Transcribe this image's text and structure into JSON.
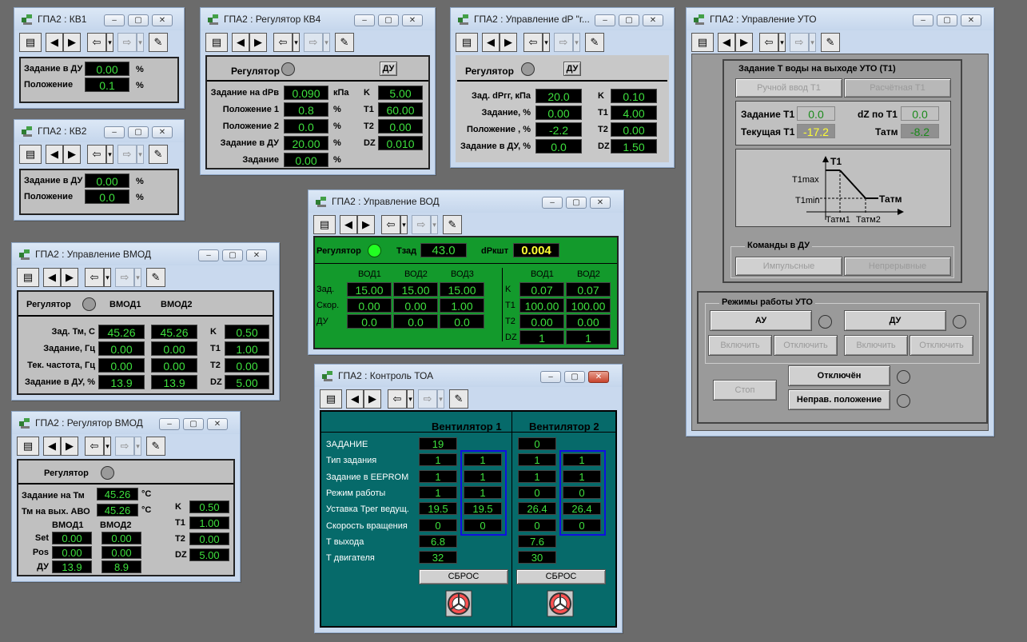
{
  "toolbar": {
    "buttons": [
      "print",
      "back",
      "forward",
      "undo",
      "redo",
      "pin"
    ],
    "icons": {
      "print": "▤",
      "back": "◀",
      "forward": "▶",
      "undo": "⇦",
      "redo": "⇨",
      "dropdown": "▾",
      "pin": "✎"
    }
  },
  "window_controls": {
    "minimize": "–",
    "restore": "▢",
    "close": "✕"
  },
  "kv1": {
    "title": "ГПА2 : КВ1",
    "rows": [
      {
        "label": "Задание в ДУ",
        "value": "0.00",
        "unit": "%"
      },
      {
        "label": "Положение",
        "value": "0.1",
        "unit": "%"
      }
    ]
  },
  "kv2": {
    "title": "ГПА2 : КВ2",
    "rows": [
      {
        "label": "Задание в ДУ",
        "value": "0.00",
        "unit": "%"
      },
      {
        "label": "Положение",
        "value": "0.0",
        "unit": "%"
      }
    ]
  },
  "kv4": {
    "title": "ГПА2 : Регулятор КВ4",
    "regulator_label": "Регулятор",
    "du_label": "ДУ",
    "rows": [
      {
        "label": "Задание на dPв",
        "value": "0.090",
        "unit": "кПа"
      },
      {
        "label": "Положение 1",
        "value": "0.8",
        "unit": "%"
      },
      {
        "label": "Положение 2",
        "value": "0.0",
        "unit": "%"
      },
      {
        "label": "Задание в ДУ",
        "value": "20.00",
        "unit": "%"
      },
      {
        "label": "Задание",
        "value": "0.00",
        "unit": "%"
      }
    ],
    "params": [
      {
        "label": "K",
        "value": "5.00"
      },
      {
        "label": "T1",
        "value": "60.00"
      },
      {
        "label": "T2",
        "value": "0.00"
      },
      {
        "label": "DZ",
        "value": "0.010"
      }
    ]
  },
  "dp": {
    "title": "ГПА2 : Управление dP \"г...",
    "regulator_label": "Регулятор",
    "du_label": "ДУ",
    "rows": [
      {
        "label": "Зад. dPгг, кПа",
        "value": "20.0"
      },
      {
        "label": "Задание, %",
        "value": "0.00"
      },
      {
        "label": "Положение , %",
        "value": "-2.2"
      },
      {
        "label": "Задание в ДУ, %",
        "value": "0.0"
      }
    ],
    "params": [
      {
        "label": "K",
        "value": "0.10"
      },
      {
        "label": "T1",
        "value": "4.00"
      },
      {
        "label": "T2",
        "value": "0.00"
      },
      {
        "label": "DZ",
        "value": "1.50"
      }
    ]
  },
  "vmod": {
    "title": "ГПА2 : Управление ВМОД",
    "regulator_label": "Регулятор",
    "col1": "ВМОД1",
    "col2": "ВМОД2",
    "rows": [
      {
        "label": "Зад. Тм, С",
        "v1": "45.26",
        "v2": "45.26"
      },
      {
        "label": "Задание, Гц",
        "v1": "0.00",
        "v2": "0.00"
      },
      {
        "label": "Тек. частота, Гц",
        "v1": "0.00",
        "v2": "0.00"
      },
      {
        "label": "Задание в ДУ, %",
        "v1": "13.9",
        "v2": "13.9"
      }
    ],
    "params": [
      {
        "label": "K",
        "value": "0.50"
      },
      {
        "label": "T1",
        "value": "1.00"
      },
      {
        "label": "T2",
        "value": "0.00"
      },
      {
        "label": "DZ",
        "value": "5.00"
      }
    ]
  },
  "regvmod": {
    "title": "ГПА2 : Регулятор ВМОД",
    "regulator_label": "Регулятор",
    "set_tm_label": "Задание на Тм",
    "set_tm_value": "45.26",
    "tm_out_label": "Тм на вых. АВО",
    "tm_out_value": "45.26",
    "temp_unit": "°C",
    "col1": "ВМОД1",
    "col2": "ВМОД2",
    "rows": [
      {
        "label": "Set",
        "v1": "0.00",
        "v2": "0.00"
      },
      {
        "label": "Pos",
        "v1": "0.00",
        "v2": "0.00"
      },
      {
        "label": "ДУ",
        "v1": "13.9",
        "v2": "8.9"
      }
    ],
    "params": [
      {
        "label": "K",
        "value": "0.50"
      },
      {
        "label": "T1",
        "value": "1.00"
      },
      {
        "label": "T2",
        "value": "0.00"
      },
      {
        "label": "DZ",
        "value": "5.00"
      }
    ]
  },
  "vod": {
    "title": "ГПА2 : Управление ВОД",
    "regulator_label": "Регулятор",
    "tzad_label": "Тзад",
    "tzad_value": "43.0",
    "dp_label": "dPкшт",
    "dp_value": "0.004",
    "cols": [
      "ВОД1",
      "ВОД2",
      "ВОД3"
    ],
    "rows": [
      {
        "label": "Зад.",
        "values": [
          "15.00",
          "15.00",
          "15.00"
        ]
      },
      {
        "label": "Скор.",
        "values": [
          "0.00",
          "0.00",
          "1.00"
        ]
      },
      {
        "label": "ДУ",
        "values": [
          "0.0",
          "0.0",
          "0.0"
        ]
      }
    ],
    "pcols": [
      "ВОД1",
      "ВОД2"
    ],
    "prows": [
      {
        "label": "K",
        "values": [
          "0.07",
          "0.07"
        ]
      },
      {
        "label": "T1",
        "values": [
          "100.00",
          "100.00"
        ]
      },
      {
        "label": "T2",
        "values": [
          "0.00",
          "0.00"
        ]
      },
      {
        "label": "DZ",
        "values": [
          "1",
          "1"
        ]
      }
    ]
  },
  "toa": {
    "title": "ГПА2 : Контроль ТОА",
    "fan1": "Вентилятор 1",
    "fan2": "Вентилятор 2",
    "reset_label": "СБРОС",
    "rows": [
      {
        "label": "ЗАДАНИЕ",
        "f1a": "19",
        "f1b": "",
        "f2a": "0",
        "f2b": ""
      },
      {
        "label": "Тип задания",
        "f1a": "1",
        "f1b": "1",
        "f2a": "1",
        "f2b": "1"
      },
      {
        "label": "Задание в EEPROM",
        "f1a": "1",
        "f1b": "1",
        "f2a": "1",
        "f2b": "1"
      },
      {
        "label": "Режим работы",
        "f1a": "1",
        "f1b": "1",
        "f2a": "0",
        "f2b": "0"
      },
      {
        "label": "Уставка Трег ведущ.",
        "f1a": "19.5",
        "f1b": "19.5",
        "f2a": "26.4",
        "f2b": "26.4"
      },
      {
        "label": "Скорость вращения",
        "f1a": "0",
        "f1b": "0",
        "f2a": "0",
        "f2b": "0"
      },
      {
        "label": "Т выхода",
        "f1a": "6.8",
        "f1b": "",
        "f2a": "7.6",
        "f2b": ""
      },
      {
        "label": "Т двигателя",
        "f1a": "32",
        "f1b": "",
        "f2a": "30",
        "f2b": ""
      }
    ]
  },
  "uto": {
    "title": "ГПА2 : Управление УТО",
    "group1": "Задание Т воды на выходе УТО (Т1)",
    "tab_manual": "Ручной ввод Т1",
    "tab_calc": "Расчётная Т1",
    "set_t1_label": "Задание Т1",
    "set_t1_value": "0.0",
    "dz_label": "dZ по Т1",
    "dz_value": "0.0",
    "cur_t1_label": "Текущая Т1",
    "cur_t1_value": "-17.2",
    "tatm_label": "Татм",
    "tatm_value": "-8.2",
    "graph": {
      "y_axis": "Т1",
      "x_axis": "Татм",
      "t1max": "T1max",
      "t1min": "T1min",
      "tatm1": "Татм1",
      "tatm2": "Татм2"
    },
    "group2": "Команды в ДУ",
    "btn_impulse": "Импульсные",
    "btn_continuous": "Непрерывные",
    "group3": "Режимы работы УТО",
    "au": "АУ",
    "du": "ДУ",
    "enable": "Включить",
    "disable": "Отключить",
    "stop": "Стоп",
    "off_label": "Отключён",
    "wrong_pos": "Неправ. положение"
  }
}
